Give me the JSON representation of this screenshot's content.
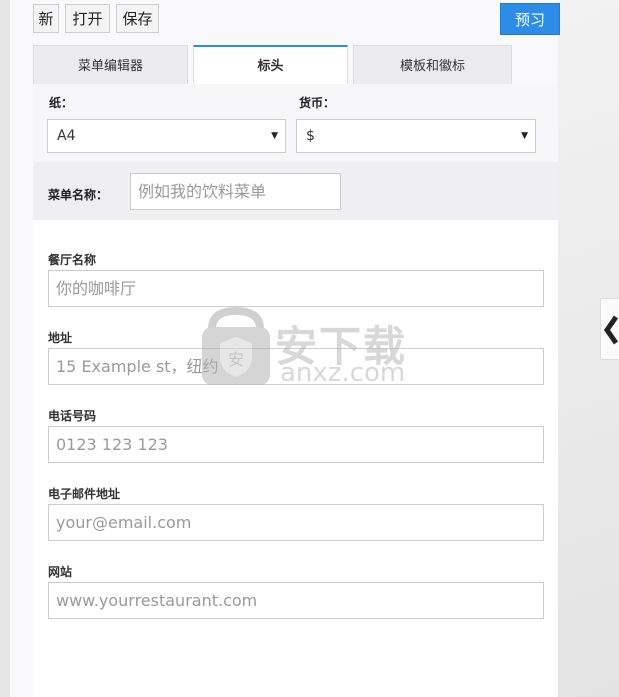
{
  "toolbar": {
    "new_label": "新",
    "open_label": "打开",
    "save_label": "保存",
    "preview_label": "预习"
  },
  "tabs": [
    {
      "label": "菜单编辑器",
      "active": false
    },
    {
      "label": "标头",
      "active": true
    },
    {
      "label": "模板和徽标",
      "active": false
    }
  ],
  "settings": {
    "paper_label": "纸：",
    "paper_value": "A4",
    "currency_label": "货币：",
    "currency_value": "$",
    "menu_name_label": "菜单名称：",
    "menu_name_placeholder": "例如我的饮料菜单"
  },
  "form": {
    "restaurant_label": "餐厅名称",
    "restaurant_placeholder": "你的咖啡厅",
    "address_label": "地址",
    "address_placeholder": "15 Example st，纽约",
    "phone_label": "电话号码",
    "phone_placeholder": "0123 123 123",
    "email_label": "电子邮件地址",
    "email_placeholder": "your@email.com",
    "website_label": "网站",
    "website_placeholder": "www.yourrestaurant.com"
  },
  "watermark": {
    "main": "安下载",
    "sub": "anxz.com"
  },
  "colors": {
    "accent": "#2d8ce8",
    "panel": "#f9f9fb"
  }
}
